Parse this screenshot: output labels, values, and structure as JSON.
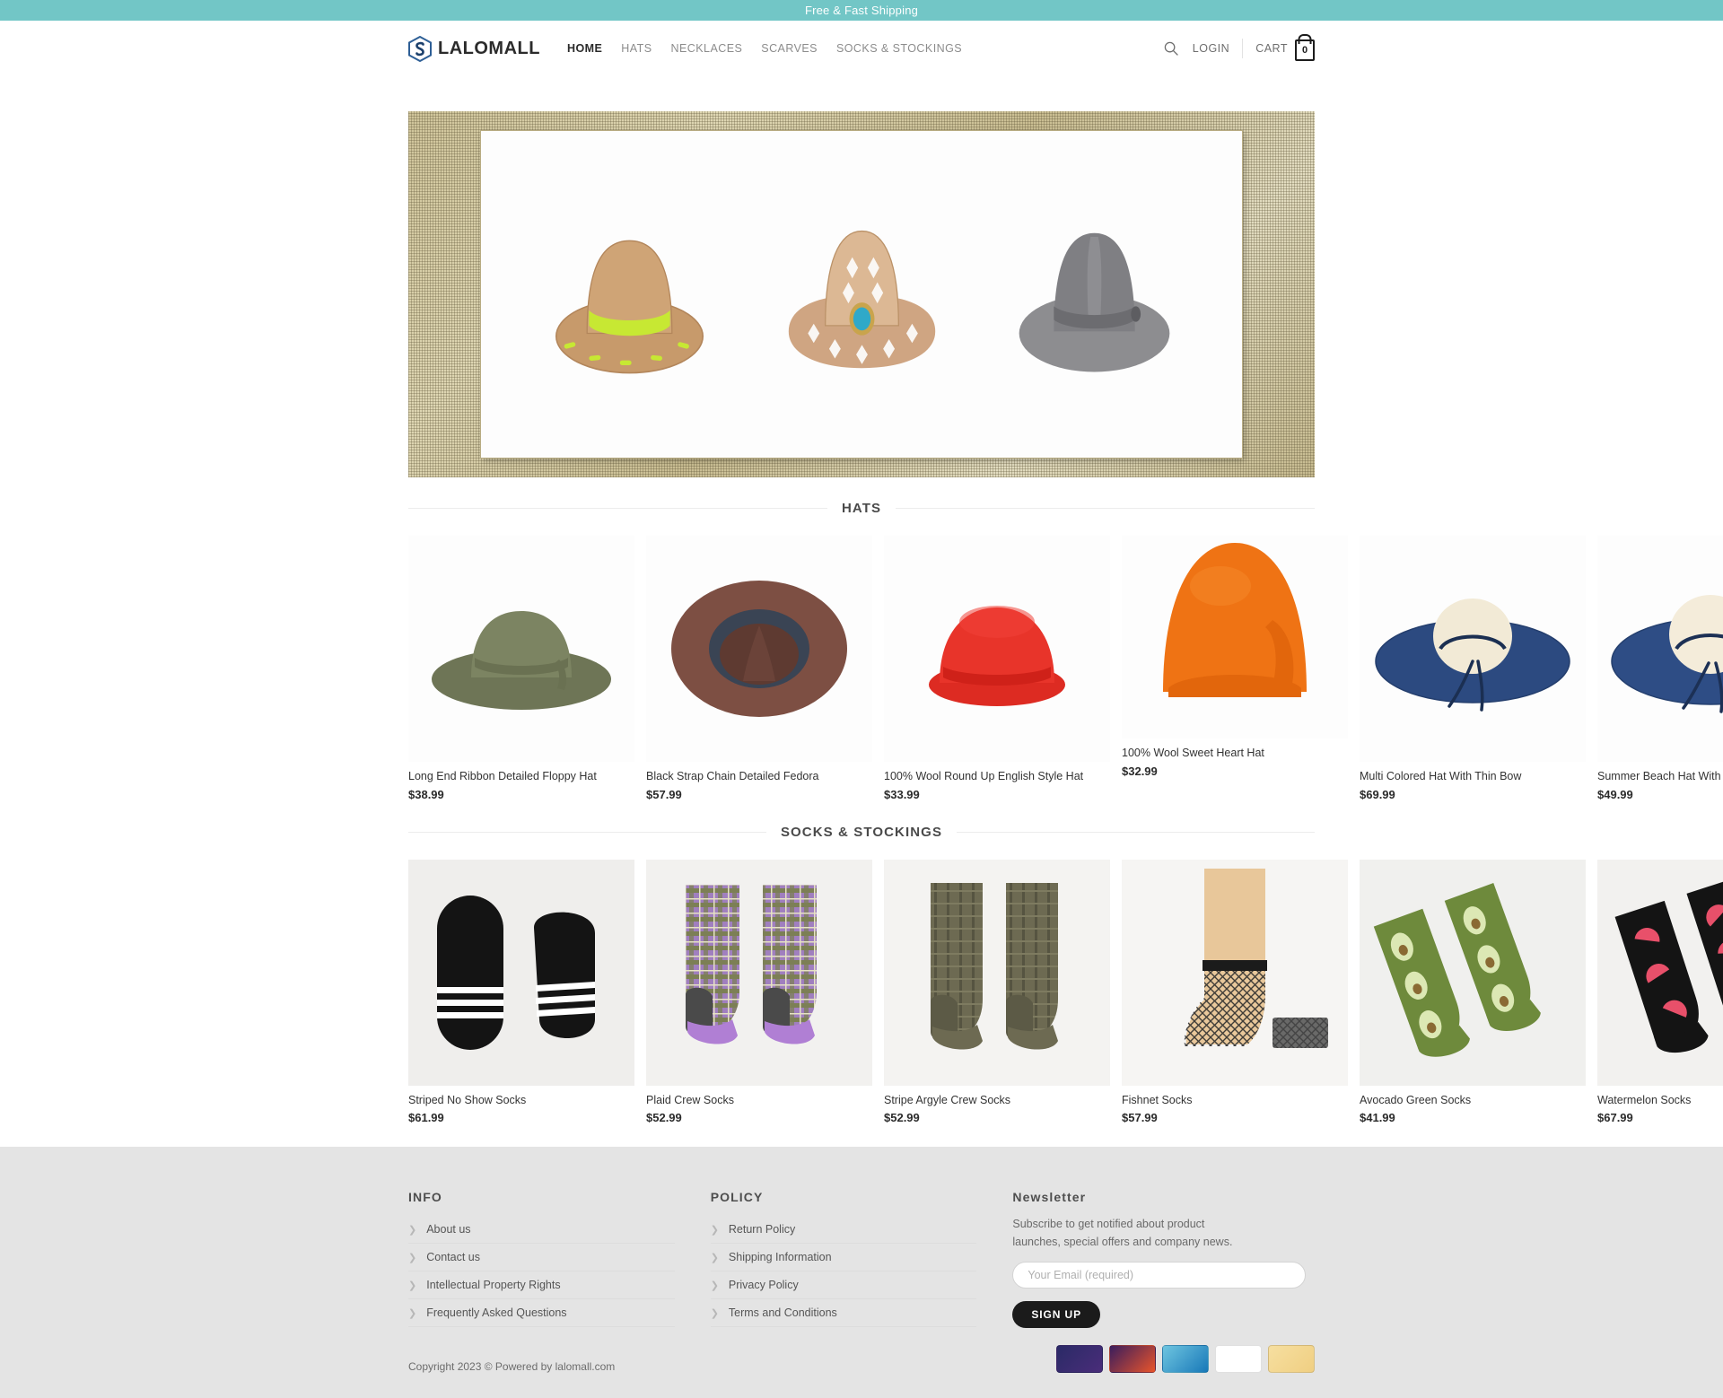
{
  "announcement": {
    "text": "Free & Fast Shipping",
    "bg": "#72c6c6"
  },
  "header": {
    "brand": "LALOMALL",
    "logo_icon": "hexagon-s-logo-icon",
    "nav": [
      {
        "label": "HOME",
        "active": true
      },
      {
        "label": "HATS",
        "active": false
      },
      {
        "label": "NECKLACES",
        "active": false
      },
      {
        "label": "SCARVES",
        "active": false
      },
      {
        "label": "SOCKS & STOCKINGS",
        "active": false
      }
    ],
    "search_icon": "search-icon",
    "login_label": "LOGIN",
    "cart_label": "CART",
    "cart_count": "0",
    "cart_icon": "shopping-bag-icon"
  },
  "hero": {
    "alt": "Three hats: tan straw fedora with lime band, tan cowboy hat with turquoise stone, grey felt fedora",
    "frame_color": "#cfc49a"
  },
  "sections": [
    {
      "title": "HATS",
      "products": [
        {
          "title": "Long End Ribbon Detailed Floppy Hat",
          "price": "$38.99",
          "image": "olive-floppy-hat"
        },
        {
          "title": "Black Strap Chain Detailed Fedora",
          "price": "$57.99",
          "image": "brown-fedora-top"
        },
        {
          "title": "100% Wool Round Up English Style Hat",
          "price": "$33.99",
          "image": "red-bowler-hat"
        },
        {
          "title": "100% Wool Sweet Heart Hat",
          "price": "$32.99",
          "image": "orange-cloche-hat"
        },
        {
          "title": "Multi Colored Hat With Thin Bow",
          "price": "$69.99",
          "image": "navy-wide-brim-hat"
        },
        {
          "title": "Summer Beach Hat With Thin Bow At",
          "price": "$49.99",
          "image": "navy-beach-hat"
        }
      ]
    },
    {
      "title": "SOCKS & STOCKINGS",
      "products": [
        {
          "title": "Striped No Show Socks",
          "price": "$61.99",
          "image": "black-striped-no-show-socks"
        },
        {
          "title": "Plaid Crew Socks",
          "price": "$52.99",
          "image": "plaid-crew-socks"
        },
        {
          "title": "Stripe Argyle Crew Socks",
          "price": "$52.99",
          "image": "olive-argyle-socks"
        },
        {
          "title": "Fishnet Socks",
          "price": "$57.99",
          "image": "fishnet-socks"
        },
        {
          "title": "Avocado Green Socks",
          "price": "$41.99",
          "image": "avocado-green-socks"
        },
        {
          "title": "Watermelon Socks",
          "price": "$67.99",
          "image": "watermelon-socks"
        }
      ]
    }
  ],
  "footer": {
    "info": {
      "title": "INFO",
      "links": [
        "About us",
        "Contact us",
        "Intellectual Property Rights",
        "Frequently Asked Questions"
      ]
    },
    "policy": {
      "title": "POLICY",
      "links": [
        "Return Policy",
        "Shipping Information",
        "Privacy Policy",
        "Terms and Conditions"
      ]
    },
    "newsletter": {
      "title": "Newsletter",
      "description": "Subscribe to get notified about product launches, special offers and company news.",
      "email_placeholder": "Your Email (required)",
      "email_value": "",
      "signup_label": "SIGN UP"
    },
    "copyright": "Copyright 2023 © Powered by lalomall.com",
    "payments": [
      {
        "name": "maestro-card-icon",
        "bg": "linear-gradient(135deg,#2a2a66,#4a2d7a)"
      },
      {
        "name": "mastercard-card-icon",
        "bg": "linear-gradient(135deg,#3a1d5d,#e8542b)"
      },
      {
        "name": "amex-card-icon",
        "bg": "linear-gradient(135deg,#6ec5e0,#1878b8)"
      },
      {
        "name": "visa-card-icon",
        "bg": "#ffffff"
      },
      {
        "name": "generic-card-icon",
        "bg": "linear-gradient(135deg,#f6dfa0,#f0cf82)"
      }
    ]
  }
}
